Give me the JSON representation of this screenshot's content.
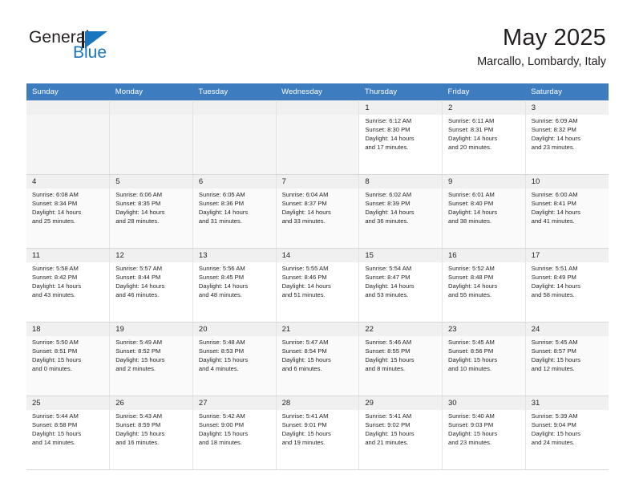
{
  "brand": {
    "name_part1": "General",
    "name_part2": "Blue",
    "accent_color": "#1b75bc"
  },
  "header": {
    "title": "May 2025",
    "subtitle": "Marcallo, Lombardy, Italy"
  },
  "calendar": {
    "header_color": "#3e7cc0",
    "weekdays": [
      "Sunday",
      "Monday",
      "Tuesday",
      "Wednesday",
      "Thursday",
      "Friday",
      "Saturday"
    ],
    "weeks": [
      [
        {
          "day": "",
          "sunrise": "",
          "sunset": "",
          "daylight1": "",
          "daylight2": "",
          "empty": true
        },
        {
          "day": "",
          "sunrise": "",
          "sunset": "",
          "daylight1": "",
          "daylight2": "",
          "empty": true
        },
        {
          "day": "",
          "sunrise": "",
          "sunset": "",
          "daylight1": "",
          "daylight2": "",
          "empty": true
        },
        {
          "day": "",
          "sunrise": "",
          "sunset": "",
          "daylight1": "",
          "daylight2": "",
          "empty": true
        },
        {
          "day": "1",
          "sunrise": "Sunrise: 6:12 AM",
          "sunset": "Sunset: 8:30 PM",
          "daylight1": "Daylight: 14 hours",
          "daylight2": "and 17 minutes."
        },
        {
          "day": "2",
          "sunrise": "Sunrise: 6:11 AM",
          "sunset": "Sunset: 8:31 PM",
          "daylight1": "Daylight: 14 hours",
          "daylight2": "and 20 minutes."
        },
        {
          "day": "3",
          "sunrise": "Sunrise: 6:09 AM",
          "sunset": "Sunset: 8:32 PM",
          "daylight1": "Daylight: 14 hours",
          "daylight2": "and 23 minutes."
        }
      ],
      [
        {
          "day": "4",
          "sunrise": "Sunrise: 6:08 AM",
          "sunset": "Sunset: 8:34 PM",
          "daylight1": "Daylight: 14 hours",
          "daylight2": "and 25 minutes."
        },
        {
          "day": "5",
          "sunrise": "Sunrise: 6:06 AM",
          "sunset": "Sunset: 8:35 PM",
          "daylight1": "Daylight: 14 hours",
          "daylight2": "and 28 minutes."
        },
        {
          "day": "6",
          "sunrise": "Sunrise: 6:05 AM",
          "sunset": "Sunset: 8:36 PM",
          "daylight1": "Daylight: 14 hours",
          "daylight2": "and 31 minutes."
        },
        {
          "day": "7",
          "sunrise": "Sunrise: 6:04 AM",
          "sunset": "Sunset: 8:37 PM",
          "daylight1": "Daylight: 14 hours",
          "daylight2": "and 33 minutes."
        },
        {
          "day": "8",
          "sunrise": "Sunrise: 6:02 AM",
          "sunset": "Sunset: 8:39 PM",
          "daylight1": "Daylight: 14 hours",
          "daylight2": "and 36 minutes."
        },
        {
          "day": "9",
          "sunrise": "Sunrise: 6:01 AM",
          "sunset": "Sunset: 8:40 PM",
          "daylight1": "Daylight: 14 hours",
          "daylight2": "and 38 minutes."
        },
        {
          "day": "10",
          "sunrise": "Sunrise: 6:00 AM",
          "sunset": "Sunset: 8:41 PM",
          "daylight1": "Daylight: 14 hours",
          "daylight2": "and 41 minutes."
        }
      ],
      [
        {
          "day": "11",
          "sunrise": "Sunrise: 5:58 AM",
          "sunset": "Sunset: 8:42 PM",
          "daylight1": "Daylight: 14 hours",
          "daylight2": "and 43 minutes."
        },
        {
          "day": "12",
          "sunrise": "Sunrise: 5:57 AM",
          "sunset": "Sunset: 8:44 PM",
          "daylight1": "Daylight: 14 hours",
          "daylight2": "and 46 minutes."
        },
        {
          "day": "13",
          "sunrise": "Sunrise: 5:56 AM",
          "sunset": "Sunset: 8:45 PM",
          "daylight1": "Daylight: 14 hours",
          "daylight2": "and 48 minutes."
        },
        {
          "day": "14",
          "sunrise": "Sunrise: 5:55 AM",
          "sunset": "Sunset: 8:46 PM",
          "daylight1": "Daylight: 14 hours",
          "daylight2": "and 51 minutes."
        },
        {
          "day": "15",
          "sunrise": "Sunrise: 5:54 AM",
          "sunset": "Sunset: 8:47 PM",
          "daylight1": "Daylight: 14 hours",
          "daylight2": "and 53 minutes."
        },
        {
          "day": "16",
          "sunrise": "Sunrise: 5:52 AM",
          "sunset": "Sunset: 8:48 PM",
          "daylight1": "Daylight: 14 hours",
          "daylight2": "and 55 minutes."
        },
        {
          "day": "17",
          "sunrise": "Sunrise: 5:51 AM",
          "sunset": "Sunset: 8:49 PM",
          "daylight1": "Daylight: 14 hours",
          "daylight2": "and 58 minutes."
        }
      ],
      [
        {
          "day": "18",
          "sunrise": "Sunrise: 5:50 AM",
          "sunset": "Sunset: 8:51 PM",
          "daylight1": "Daylight: 15 hours",
          "daylight2": "and 0 minutes."
        },
        {
          "day": "19",
          "sunrise": "Sunrise: 5:49 AM",
          "sunset": "Sunset: 8:52 PM",
          "daylight1": "Daylight: 15 hours",
          "daylight2": "and 2 minutes."
        },
        {
          "day": "20",
          "sunrise": "Sunrise: 5:48 AM",
          "sunset": "Sunset: 8:53 PM",
          "daylight1": "Daylight: 15 hours",
          "daylight2": "and 4 minutes."
        },
        {
          "day": "21",
          "sunrise": "Sunrise: 5:47 AM",
          "sunset": "Sunset: 8:54 PM",
          "daylight1": "Daylight: 15 hours",
          "daylight2": "and 6 minutes."
        },
        {
          "day": "22",
          "sunrise": "Sunrise: 5:46 AM",
          "sunset": "Sunset: 8:55 PM",
          "daylight1": "Daylight: 15 hours",
          "daylight2": "and 8 minutes."
        },
        {
          "day": "23",
          "sunrise": "Sunrise: 5:45 AM",
          "sunset": "Sunset: 8:56 PM",
          "daylight1": "Daylight: 15 hours",
          "daylight2": "and 10 minutes."
        },
        {
          "day": "24",
          "sunrise": "Sunrise: 5:45 AM",
          "sunset": "Sunset: 8:57 PM",
          "daylight1": "Daylight: 15 hours",
          "daylight2": "and 12 minutes."
        }
      ],
      [
        {
          "day": "25",
          "sunrise": "Sunrise: 5:44 AM",
          "sunset": "Sunset: 8:58 PM",
          "daylight1": "Daylight: 15 hours",
          "daylight2": "and 14 minutes."
        },
        {
          "day": "26",
          "sunrise": "Sunrise: 5:43 AM",
          "sunset": "Sunset: 8:59 PM",
          "daylight1": "Daylight: 15 hours",
          "daylight2": "and 16 minutes."
        },
        {
          "day": "27",
          "sunrise": "Sunrise: 5:42 AM",
          "sunset": "Sunset: 9:00 PM",
          "daylight1": "Daylight: 15 hours",
          "daylight2": "and 18 minutes."
        },
        {
          "day": "28",
          "sunrise": "Sunrise: 5:41 AM",
          "sunset": "Sunset: 9:01 PM",
          "daylight1": "Daylight: 15 hours",
          "daylight2": "and 19 minutes."
        },
        {
          "day": "29",
          "sunrise": "Sunrise: 5:41 AM",
          "sunset": "Sunset: 9:02 PM",
          "daylight1": "Daylight: 15 hours",
          "daylight2": "and 21 minutes."
        },
        {
          "day": "30",
          "sunrise": "Sunrise: 5:40 AM",
          "sunset": "Sunset: 9:03 PM",
          "daylight1": "Daylight: 15 hours",
          "daylight2": "and 23 minutes."
        },
        {
          "day": "31",
          "sunrise": "Sunrise: 5:39 AM",
          "sunset": "Sunset: 9:04 PM",
          "daylight1": "Daylight: 15 hours",
          "daylight2": "and 24 minutes."
        }
      ]
    ]
  }
}
